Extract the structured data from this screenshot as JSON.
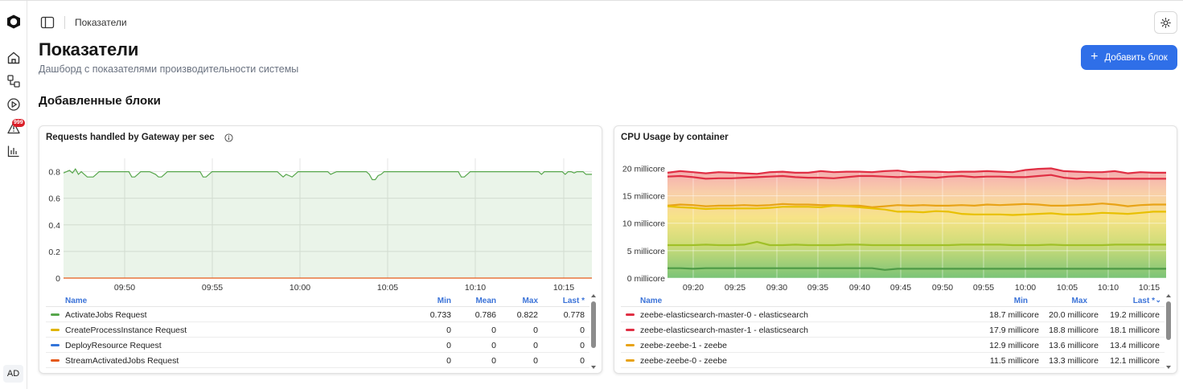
{
  "breadcrumb": "Показатели",
  "page": {
    "title": "Показатели",
    "subtitle": "Дашборд с показателями производительности системы",
    "add_button": "Добавить блок",
    "section_title": "Добавленные блоки"
  },
  "sidebar": {
    "alerts_badge": "999",
    "avatar": "AD",
    "items": [
      "home-icon",
      "processes-icon",
      "play-icon",
      "alert-icon",
      "chart-icon"
    ]
  },
  "colors": {
    "accent": "#2f6fe8",
    "green": "#56a64b",
    "yellow": "#e0b400",
    "blue": "#3274d9",
    "orange": "#e55a1a",
    "red": "#e02f44"
  },
  "panel1": {
    "title": "Requests handled by Gateway per sec",
    "headers": {
      "name": "Name",
      "min": "Min",
      "mean": "Mean",
      "max": "Max",
      "last": "Last *"
    },
    "rows": [
      {
        "name": "ActivateJobs Request",
        "color": "#56a64b",
        "min": "0.733",
        "mean": "0.786",
        "max": "0.822",
        "last": "0.778"
      },
      {
        "name": "CreateProcessInstance Request",
        "color": "#e0b400",
        "min": "0",
        "mean": "0",
        "max": "0",
        "last": "0"
      },
      {
        "name": "DeployResource Request",
        "color": "#3274d9",
        "min": "0",
        "mean": "0",
        "max": "0",
        "last": "0"
      },
      {
        "name": "StreamActivatedJobs Request",
        "color": "#e55a1a",
        "min": "0",
        "mean": "0",
        "max": "0",
        "last": "0"
      }
    ]
  },
  "panel2": {
    "title": "CPU Usage by container",
    "headers": {
      "name": "Name",
      "min": "Min",
      "max": "Max",
      "last": "Last *"
    },
    "rows": [
      {
        "name": "zeebe-elasticsearch-master-0 - elasticsearch",
        "color": "#e02f44",
        "min": "18.7 millicore",
        "max": "20.0 millicore",
        "last": "19.2 millicore"
      },
      {
        "name": "zeebe-elasticsearch-master-1 - elasticsearch",
        "color": "#e02f44",
        "min": "17.9 millicore",
        "max": "18.8 millicore",
        "last": "18.1 millicore"
      },
      {
        "name": "zeebe-zeebe-1 - zeebe",
        "color": "#e8a317",
        "min": "12.9 millicore",
        "max": "13.6 millicore",
        "last": "13.4 millicore"
      },
      {
        "name": "zeebe-zeebe-0 - zeebe",
        "color": "#e8a317",
        "min": "11.5 millicore",
        "max": "13.3 millicore",
        "last": "12.1 millicore"
      }
    ]
  },
  "chart_data": [
    {
      "type": "line",
      "title": "Requests handled by Gateway per sec",
      "ylim": [
        0,
        0.9
      ],
      "yticks": [
        "0",
        "0.2",
        "0.4",
        "0.6",
        "0.8"
      ],
      "xticks": [
        "09:50",
        "09:55",
        "10:00",
        "10:05",
        "10:10",
        "10:15"
      ],
      "series": [
        {
          "name": "ActivateJobs Request",
          "color": "#56a64b",
          "fill": true,
          "values": [
            0.79,
            0.8,
            0.81,
            0.79,
            0.82,
            0.78,
            0.8,
            0.78,
            0.76,
            0.76,
            0.76,
            0.78,
            0.8,
            0.8,
            0.8,
            0.8,
            0.8,
            0.8,
            0.8,
            0.8,
            0.8,
            0.8,
            0.8,
            0.76,
            0.76,
            0.78,
            0.8,
            0.8,
            0.8,
            0.8,
            0.79,
            0.78,
            0.76,
            0.76,
            0.78,
            0.8,
            0.8,
            0.8,
            0.8,
            0.8,
            0.8,
            0.8,
            0.8,
            0.8,
            0.8,
            0.8,
            0.8,
            0.76,
            0.76,
            0.78,
            0.8,
            0.8,
            0.8,
            0.8,
            0.8,
            0.8,
            0.8,
            0.8,
            0.8,
            0.8,
            0.8,
            0.8,
            0.8,
            0.8,
            0.8,
            0.8,
            0.8,
            0.8,
            0.8,
            0.8,
            0.8,
            0.8,
            0.8,
            0.78,
            0.76,
            0.78,
            0.77,
            0.76,
            0.78,
            0.8,
            0.8,
            0.8,
            0.8,
            0.8,
            0.8,
            0.8,
            0.8,
            0.8,
            0.8,
            0.8,
            0.78,
            0.79,
            0.8,
            0.8,
            0.8,
            0.8,
            0.8,
            0.8,
            0.8,
            0.8,
            0.8,
            0.8,
            0.8,
            0.78,
            0.74,
            0.74,
            0.77,
            0.78,
            0.8,
            0.8,
            0.8,
            0.8,
            0.8,
            0.8,
            0.8,
            0.8,
            0.8,
            0.8,
            0.8,
            0.8,
            0.8,
            0.8,
            0.8,
            0.8,
            0.8,
            0.8,
            0.8,
            0.8,
            0.8,
            0.8,
            0.8,
            0.8,
            0.8,
            0.8,
            0.76,
            0.76,
            0.78,
            0.8,
            0.8,
            0.8,
            0.8,
            0.8,
            0.8,
            0.8,
            0.8,
            0.8,
            0.8,
            0.8,
            0.8,
            0.8,
            0.8,
            0.8,
            0.8,
            0.8,
            0.8,
            0.8,
            0.8,
            0.8,
            0.8,
            0.8,
            0.8,
            0.78,
            0.8,
            0.8,
            0.8,
            0.8,
            0.8,
            0.8,
            0.8,
            0.78,
            0.8,
            0.8,
            0.79,
            0.8,
            0.8,
            0.8,
            0.78,
            0.78,
            0.78
          ]
        },
        {
          "name": "StreamActivatedJobs Request",
          "color": "#e55a1a",
          "fill": false,
          "values": [
            0,
            0
          ]
        }
      ]
    },
    {
      "type": "area",
      "title": "CPU Usage by container",
      "ylim": [
        0,
        20
      ],
      "yticks": [
        "0 millicore",
        "5 millicore",
        "10 millicore",
        "15 millicore",
        "20 millicore"
      ],
      "xticks": [
        "09:20",
        "09:25",
        "09:30",
        "09:35",
        "09:40",
        "09:45",
        "09:50",
        "09:55",
        "10:00",
        "10:05",
        "10:10",
        "10:15"
      ],
      "series": [
        {
          "name": "zeebe-elasticsearch-master-0 - elasticsearch",
          "color": "#e02f44",
          "values": [
            19.2,
            19.5,
            19.3,
            19.1,
            19.3,
            19.2,
            19.1,
            19.0,
            19.3,
            19.4,
            19.2,
            19.2,
            19.5,
            19.3,
            19.4,
            19.4,
            19.3,
            19.5,
            19.6,
            19.3,
            19.4,
            19.4,
            19.3,
            19.4,
            19.4,
            19.5,
            19.4,
            19.3,
            19.7,
            19.9,
            20.0,
            19.5,
            19.4,
            19.3,
            19.3,
            19.5,
            19.1,
            19.3,
            19.2,
            19.2
          ]
        },
        {
          "name": "zeebe-elasticsearch-master-1 - elasticsearch",
          "color": "#e02f44",
          "values": [
            18.5,
            18.6,
            18.4,
            18.1,
            18.2,
            18.2,
            18.3,
            18.4,
            18.5,
            18.6,
            18.4,
            18.3,
            18.3,
            18.2,
            18.4,
            18.6,
            18.6,
            18.5,
            18.4,
            18.5,
            18.4,
            18.3,
            18.5,
            18.6,
            18.4,
            18.5,
            18.5,
            18.4,
            18.4,
            18.6,
            18.8,
            18.3,
            18.1,
            18.3,
            18.1,
            18.1,
            18.1,
            18.1,
            18.1,
            18.1
          ]
        },
        {
          "name": "zeebe-zeebe-1 - zeebe",
          "color": "#e8a317",
          "values": [
            13.2,
            13.4,
            13.3,
            13.1,
            13.2,
            13.2,
            13.3,
            13.2,
            13.3,
            13.5,
            13.4,
            13.4,
            13.3,
            13.3,
            13.2,
            13.2,
            12.9,
            13.1,
            13.3,
            13.2,
            13.3,
            13.2,
            13.2,
            13.3,
            13.2,
            13.4,
            13.3,
            13.4,
            13.5,
            13.4,
            13.2,
            13.2,
            13.3,
            13.4,
            13.6,
            13.4,
            13.1,
            13.3,
            13.4,
            13.4
          ]
        },
        {
          "name": "zeebe-zeebe-0 - zeebe",
          "color": "#e8c000",
          "values": [
            13.1,
            12.9,
            12.8,
            12.6,
            12.7,
            12.7,
            12.7,
            12.7,
            12.8,
            13.0,
            13.0,
            13.0,
            12.9,
            13.2,
            13.1,
            12.9,
            12.7,
            12.5,
            12.1,
            12.1,
            12.0,
            12.2,
            12.1,
            11.7,
            11.6,
            11.6,
            11.6,
            11.5,
            11.6,
            11.7,
            11.8,
            11.6,
            11.6,
            11.7,
            11.9,
            11.8,
            11.7,
            11.9,
            12.1,
            12.1
          ]
        },
        {
          "name": "",
          "color": "#a0c028",
          "values": [
            6.0,
            6.0,
            6.0,
            6.1,
            6.0,
            6.0,
            6.1,
            6.6,
            6.0,
            6.0,
            6.1,
            6.0,
            6.0,
            6.0,
            6.1,
            6.1,
            6.0,
            6.0,
            6.0,
            6.0,
            6.0,
            6.0,
            6.0,
            6.1,
            6.1,
            6.1,
            6.1,
            6.0,
            6.0,
            6.0,
            6.1,
            6.0,
            6.0,
            6.0,
            6.0,
            6.1,
            6.1,
            6.1,
            6.1,
            6.1
          ]
        },
        {
          "name": "",
          "color": "#4e9a46",
          "values": [
            1.8,
            1.8,
            1.7,
            1.8,
            1.8,
            1.8,
            1.8,
            1.8,
            1.8,
            1.8,
            1.8,
            1.8,
            1.8,
            1.8,
            1.8,
            1.8,
            1.8,
            1.5,
            1.7,
            1.7,
            1.7,
            1.7,
            1.7,
            1.7,
            1.7,
            1.7,
            1.7,
            1.7,
            1.7,
            1.7,
            1.7,
            1.7,
            1.7,
            1.7,
            1.7,
            1.7,
            1.7,
            1.7,
            1.7,
            1.7
          ]
        }
      ]
    }
  ]
}
